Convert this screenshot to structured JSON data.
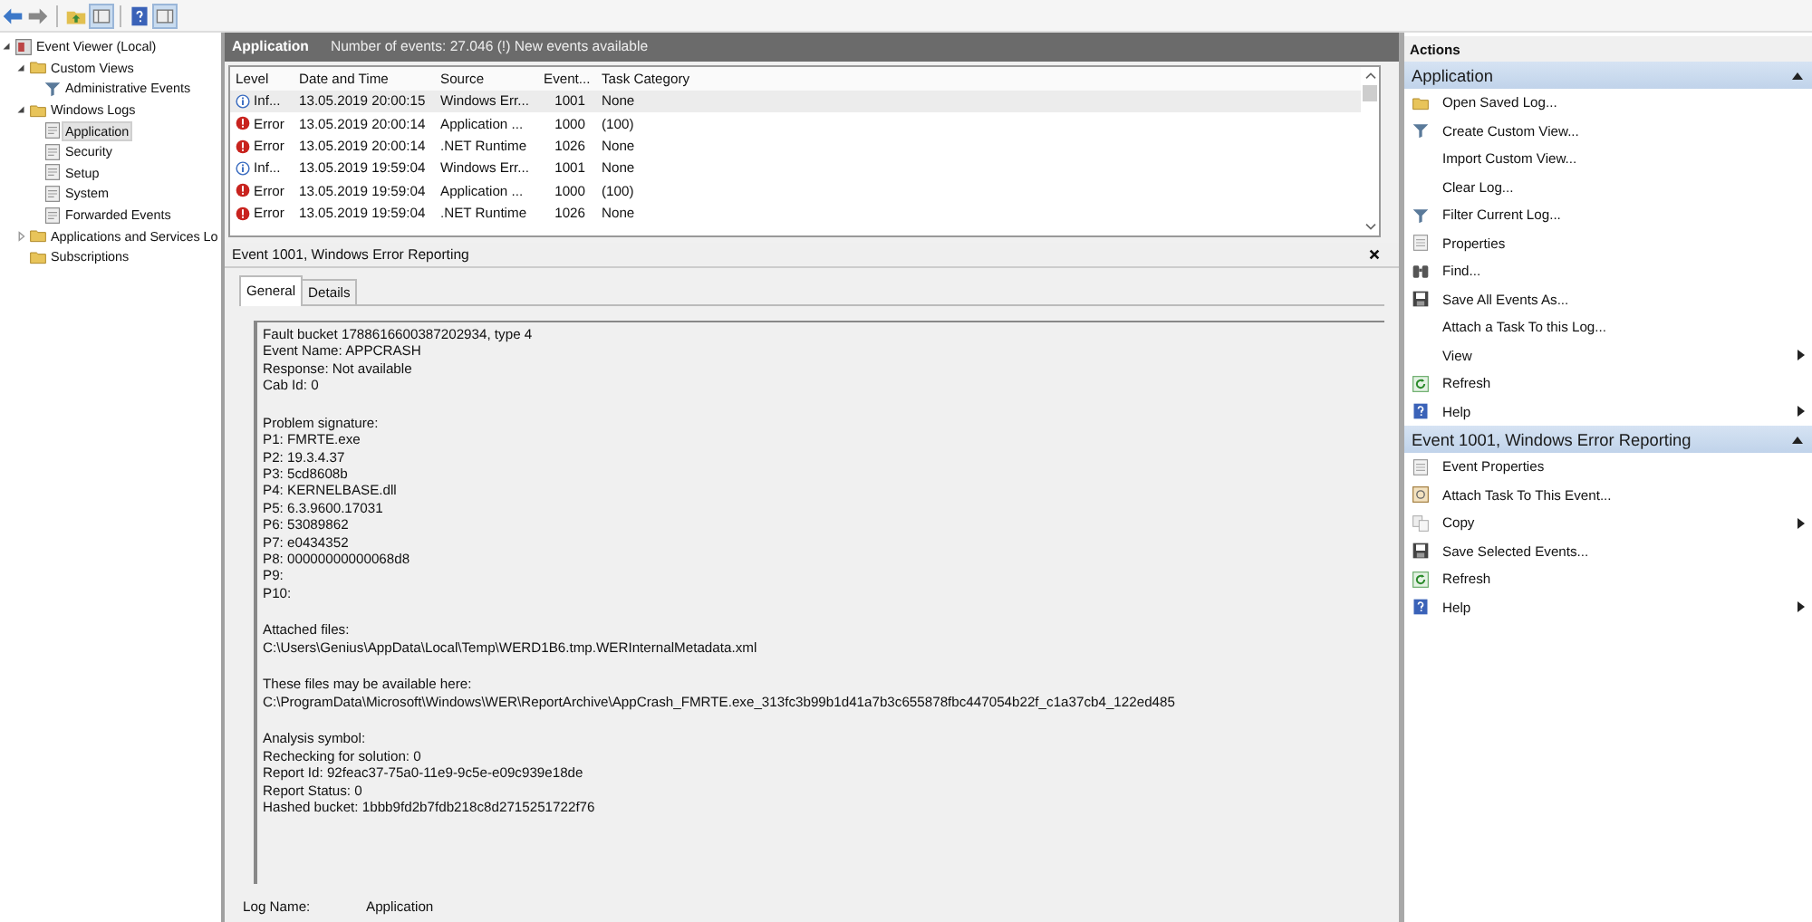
{
  "tree": [
    {
      "label": "Event Viewer (Local)",
      "kind": "viewer",
      "selected": false,
      "expanded": true,
      "children": [
        {
          "label": "Custom Views",
          "kind": "folder",
          "selected": false,
          "expanded": true,
          "children": [
            {
              "label": "Administrative Events",
              "kind": "filter",
              "selected": false
            }
          ]
        },
        {
          "label": "Windows Logs",
          "kind": "folder",
          "selected": false,
          "expanded": true,
          "children": [
            {
              "label": "Application",
              "kind": "log",
              "selected": true
            },
            {
              "label": "Security",
              "kind": "log",
              "selected": false
            },
            {
              "label": "Setup",
              "kind": "log",
              "selected": false
            },
            {
              "label": "System",
              "kind": "log",
              "selected": false
            },
            {
              "label": "Forwarded Events",
              "kind": "log",
              "selected": false
            }
          ]
        },
        {
          "label": "Applications and Services Lo",
          "kind": "folder",
          "selected": false,
          "expanded": false
        },
        {
          "label": "Subscriptions",
          "kind": "folder",
          "selected": false
        }
      ]
    }
  ],
  "log_header": {
    "title": "Application",
    "summary": "Number of events: 27.046 (!) New events available"
  },
  "table": {
    "columns": [
      "Level",
      "Date and Time",
      "Source",
      "Event...",
      "Task Category"
    ],
    "rows": [
      {
        "kind": "info",
        "level": "Inf...",
        "date": "13.05.2019 20:00:15",
        "source": "Windows Err...",
        "event_id": "1001",
        "category": "None",
        "selected": true
      },
      {
        "kind": "error",
        "level": "Error",
        "date": "13.05.2019 20:00:14",
        "source": "Application ...",
        "event_id": "1000",
        "category": "(100)",
        "selected": false
      },
      {
        "kind": "error",
        "level": "Error",
        "date": "13.05.2019 20:00:14",
        "source": ".NET Runtime",
        "event_id": "1026",
        "category": "None",
        "selected": false
      },
      {
        "kind": "info",
        "level": "Inf...",
        "date": "13.05.2019 19:59:04",
        "source": "Windows Err...",
        "event_id": "1001",
        "category": "None",
        "selected": false
      },
      {
        "kind": "error",
        "level": "Error",
        "date": "13.05.2019 19:59:04",
        "source": "Application ...",
        "event_id": "1000",
        "category": "(100)",
        "selected": false
      },
      {
        "kind": "error",
        "level": "Error",
        "date": "13.05.2019 19:59:04",
        "source": ".NET Runtime",
        "event_id": "1026",
        "category": "None",
        "selected": false
      }
    ]
  },
  "event_panel": {
    "title": "Event 1001, Windows Error Reporting",
    "tabs": [
      {
        "label": "General",
        "selected": true
      },
      {
        "label": "Details",
        "selected": false
      }
    ],
    "description": [
      [
        "Fault bucket 1788616600387202934, type 4",
        "Event Name: APPCRASH",
        "Response: Not available",
        "Cab Id: 0"
      ],
      [
        "Problem signature:",
        "P1: FMRTE.exe",
        "P2: 19.3.4.37",
        "P3: 5cd8608b",
        "P4: KERNELBASE.dll",
        "P5: 6.3.9600.17031",
        "P6: 53089862",
        "P7: e0434352",
        "P8: 00000000000068d8",
        "P9:",
        "P10:"
      ],
      [
        "Attached files:",
        "C:\\Users\\Genius\\AppData\\Local\\Temp\\WERD1B6.tmp.WERInternalMetadata.xml"
      ],
      [
        "These files may be available here:",
        "C:\\ProgramData\\Microsoft\\Windows\\WER\\ReportArchive\\AppCrash_FMRTE.exe_313fc3b99b1d41a7b3c655878fbc447054b22f_c1a37cb4_122ed485"
      ],
      [
        "Analysis symbol:",
        "Rechecking for solution: 0",
        "Report Id: 92feac37-75a0-11e9-9c5e-e09c939e18de",
        "Report Status: 0",
        "Hashed bucket: 1bbb9fd2b7fdb218c8d2715251722f76"
      ]
    ],
    "fields": [
      {
        "label": "Log Name:",
        "value": "Application"
      }
    ]
  },
  "actions": {
    "title": "Actions",
    "sections": [
      {
        "title": "Application",
        "items": [
          {
            "label": "Open Saved Log...",
            "kind": "folder",
            "submenu": false
          },
          {
            "label": "Create Custom View...",
            "kind": "filter",
            "submenu": false
          },
          {
            "label": "Import Custom View...",
            "kind": "plain",
            "submenu": false
          },
          {
            "label": "Clear Log...",
            "kind": "plain",
            "submenu": false
          },
          {
            "label": "Filter Current Log...",
            "kind": "filter",
            "submenu": false
          },
          {
            "label": "Properties",
            "kind": "properties",
            "submenu": false
          },
          {
            "label": "Find...",
            "kind": "find",
            "submenu": false
          },
          {
            "label": "Save All Events As...",
            "kind": "save",
            "submenu": false
          },
          {
            "label": "Attach a Task To this Log...",
            "kind": "plain",
            "submenu": false
          },
          {
            "label": "View",
            "kind": "plain",
            "submenu": true
          },
          {
            "label": "Refresh",
            "kind": "refresh",
            "submenu": false
          },
          {
            "label": "Help",
            "kind": "help",
            "submenu": true
          }
        ]
      },
      {
        "title": "Event 1001, Windows Error Reporting",
        "items": [
          {
            "label": "Event Properties",
            "kind": "properties",
            "submenu": false
          },
          {
            "label": "Attach Task To This Event...",
            "kind": "task",
            "submenu": false
          },
          {
            "label": "Copy",
            "kind": "copy",
            "submenu": true
          },
          {
            "label": "Save Selected Events...",
            "kind": "save",
            "submenu": false
          },
          {
            "label": "Refresh",
            "kind": "refresh",
            "submenu": false
          },
          {
            "label": "Help",
            "kind": "help",
            "submenu": true
          }
        ]
      }
    ]
  }
}
